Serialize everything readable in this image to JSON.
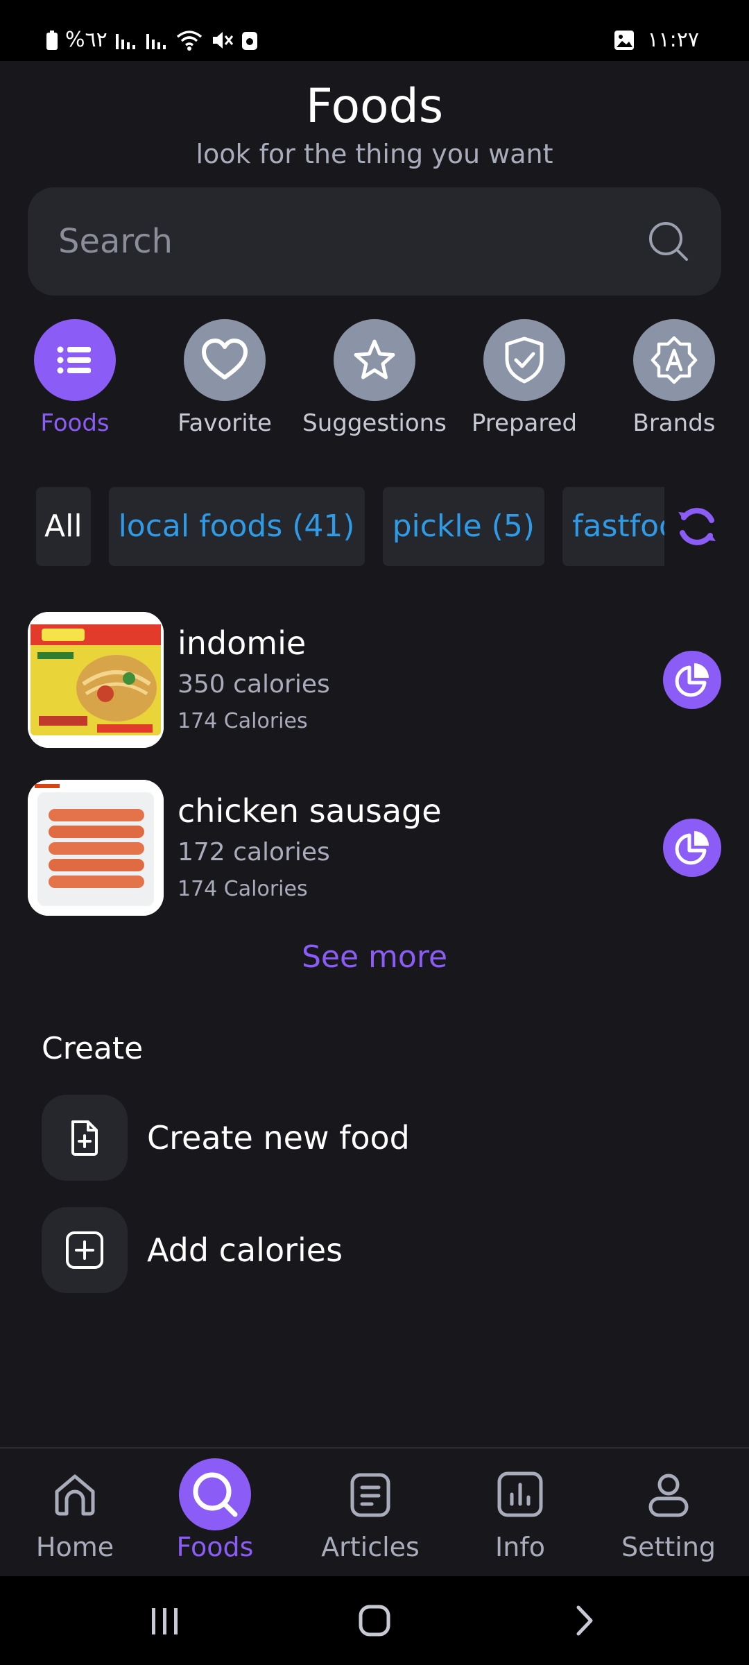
{
  "status_bar": {
    "battery_percent": "%٦٢",
    "time": "١١:٢٧"
  },
  "header": {
    "title": "Foods",
    "subtitle": "look for the thing you want"
  },
  "search": {
    "placeholder": "Search"
  },
  "categories": [
    {
      "label": "Foods",
      "icon": "list-icon",
      "active": true
    },
    {
      "label": "Favorite",
      "icon": "heart-icon",
      "active": false
    },
    {
      "label": "Suggestions",
      "icon": "star-icon",
      "active": false
    },
    {
      "label": "Prepared",
      "icon": "shield-check-icon",
      "active": false
    },
    {
      "label": "Brands",
      "icon": "badge-a-icon",
      "active": false
    }
  ],
  "filters": {
    "chips": [
      "All",
      "local foods (41)",
      "pickle (5)",
      "fastfood"
    ],
    "refresh_icon": "refresh-icon"
  },
  "foods": [
    {
      "name": "indomie",
      "calories": "350 calories",
      "secondary": "174 Calories",
      "image": "indomie-package"
    },
    {
      "name": "chicken sausage",
      "calories": "172 calories",
      "secondary": "174 Calories",
      "image": "sausage-package"
    }
  ],
  "see_more": "See more",
  "create": {
    "title": "Create",
    "items": [
      {
        "label": "Create new food",
        "icon": "file-plus-icon"
      },
      {
        "label": "Add calories",
        "icon": "square-plus-icon"
      }
    ]
  },
  "bottom_nav": [
    {
      "label": "Home",
      "icon": "home-icon",
      "active": false
    },
    {
      "label": "Foods",
      "icon": "search-icon",
      "active": true
    },
    {
      "label": "Articles",
      "icon": "article-icon",
      "active": false
    },
    {
      "label": "Info",
      "icon": "chart-icon",
      "active": false
    },
    {
      "label": "Setting",
      "icon": "user-icon",
      "active": false
    }
  ],
  "colors": {
    "background": "#18181c",
    "accent": "#8b5cf6",
    "chip_text": "#2f9be7",
    "muted": "#a9adbb"
  }
}
